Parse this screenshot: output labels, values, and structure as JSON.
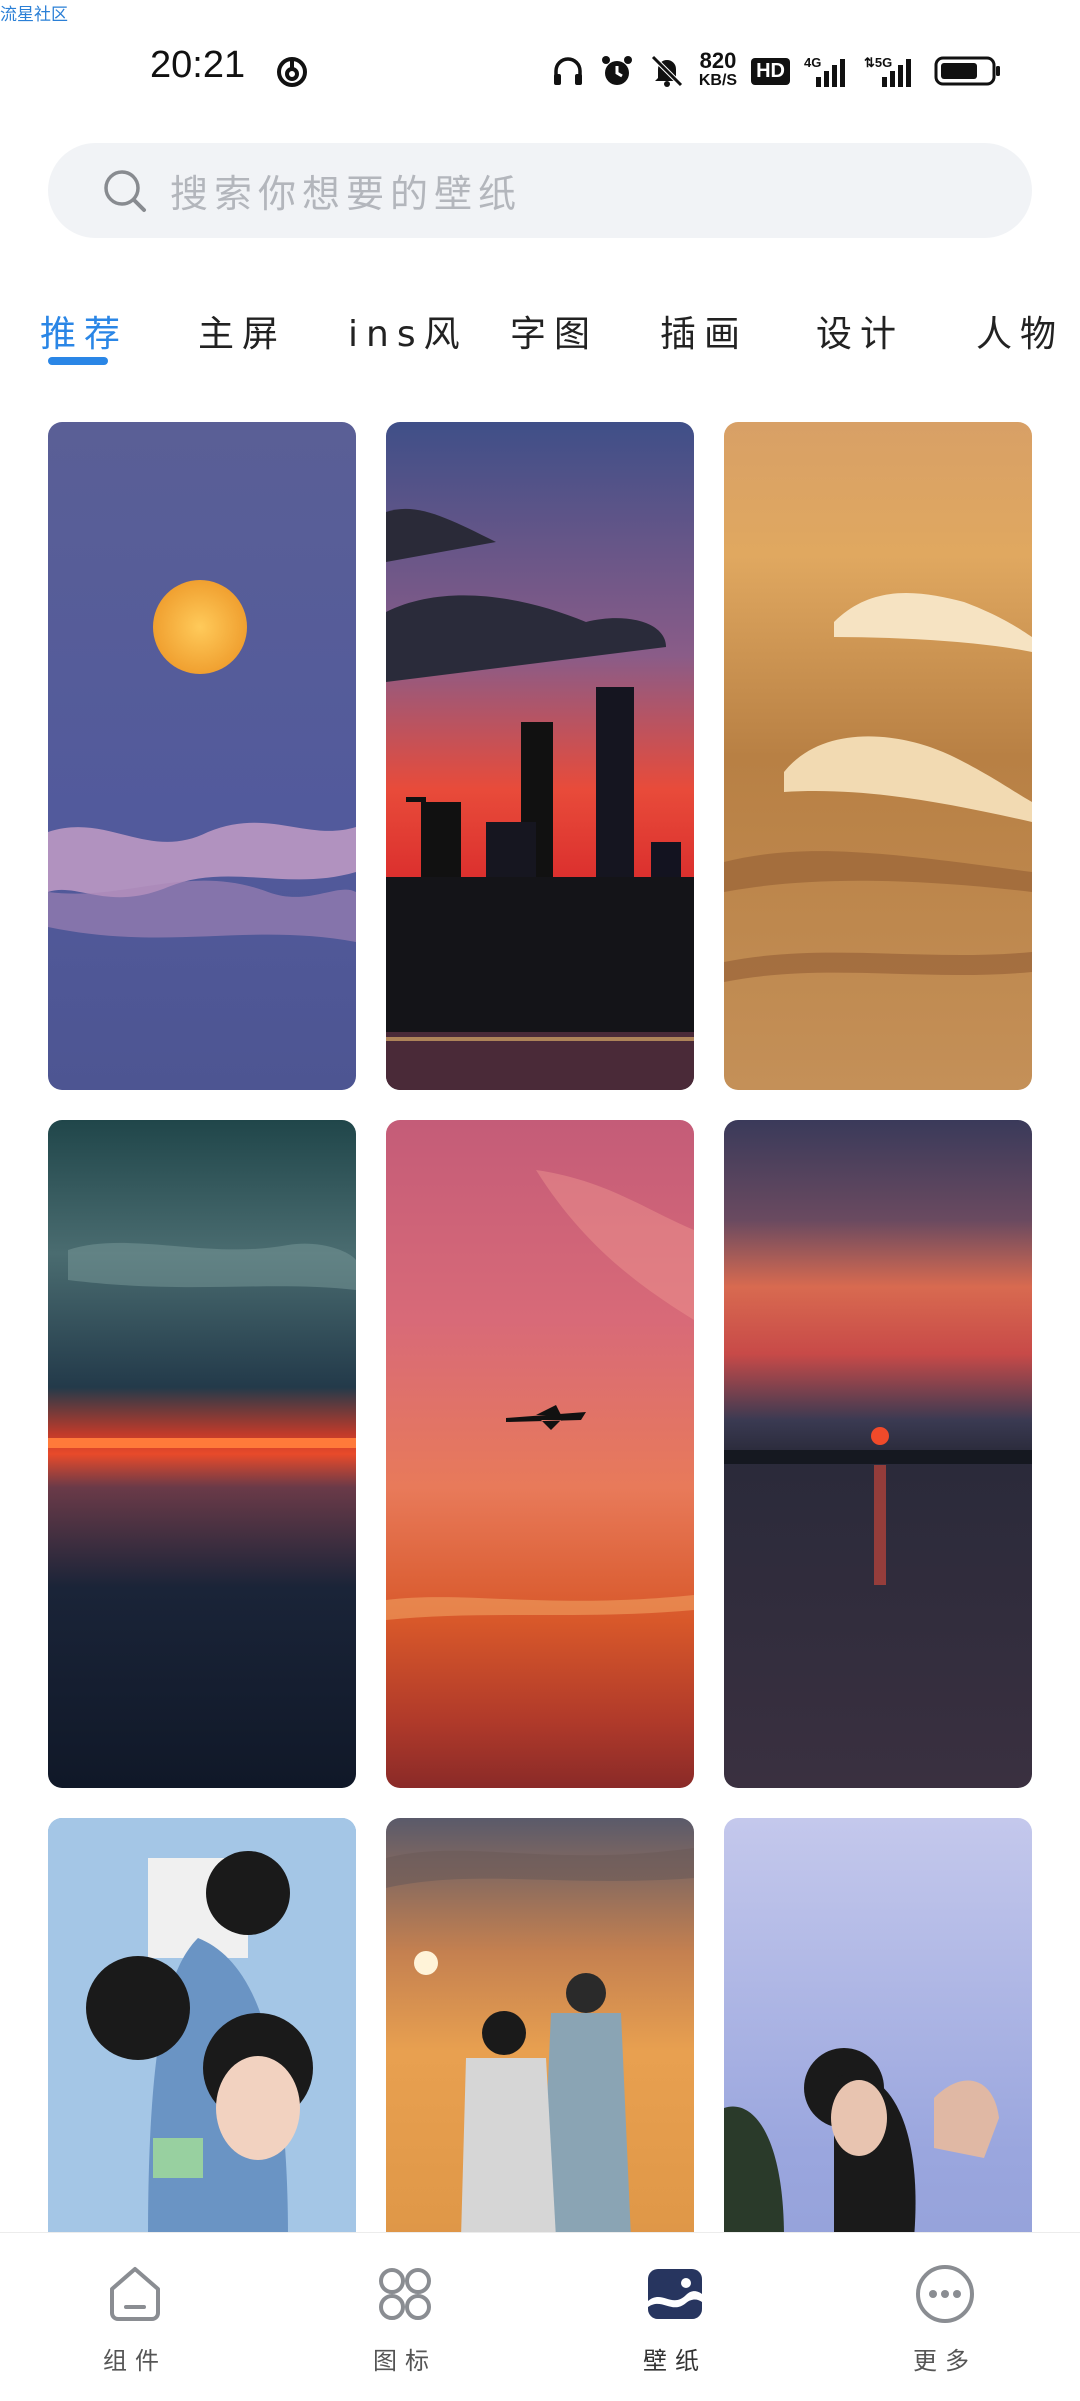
{
  "watermark": "流星社区",
  "status": {
    "time": "20:21",
    "net_speed_value": "820",
    "net_speed_unit": "KB/S",
    "hd": "HD",
    "sig1": "4G",
    "sig2": "5G"
  },
  "search": {
    "placeholder": "搜索你想要的壁纸"
  },
  "tabs": [
    {
      "label": "推荐",
      "active": true
    },
    {
      "label": "主屏"
    },
    {
      "label": "ins风"
    },
    {
      "label": "字图"
    },
    {
      "label": "插画"
    },
    {
      "label": "设计"
    },
    {
      "label": "人物"
    }
  ],
  "wallpapers": [
    {
      "subject": "full moon above clouds"
    },
    {
      "subject": "city skyline at sunset"
    },
    {
      "subject": "golden ocean waves"
    },
    {
      "subject": "dark horizon with red glow"
    },
    {
      "subject": "airplane in pink sunset sky"
    },
    {
      "subject": "sunset over lake"
    },
    {
      "subject": "graduates in blue gowns"
    },
    {
      "subject": "couple at sunset beach"
    },
    {
      "subject": "girl by the sea"
    }
  ],
  "bottom_nav": [
    {
      "label": "组件",
      "icon": "widget-icon"
    },
    {
      "label": "图标",
      "icon": "icons-grid-icon"
    },
    {
      "label": "壁纸",
      "icon": "wallpaper-icon",
      "active": true
    },
    {
      "label": "更多",
      "icon": "more-icon"
    }
  ]
}
